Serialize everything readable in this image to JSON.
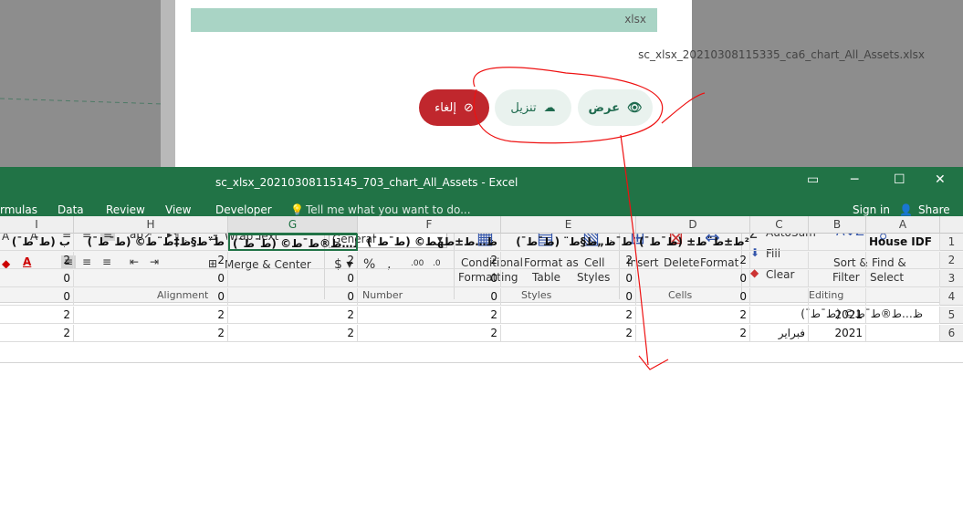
{
  "dialog": {
    "file_type": "xlsx",
    "file_name": "sc_xlsx_20210308115335_ca6_chart_All_Assets.xlsx",
    "view_label": "عرض",
    "download_label": "تنزيل",
    "cancel_label": "إلغاء"
  },
  "excel": {
    "window_title": "sc_xlsx_20210308115145_703_chart_All_Assets - Excel",
    "tabs": [
      "rmulas",
      "Data",
      "Review",
      "View",
      "Developer"
    ],
    "tell_me": "Tell me what you want to do...",
    "sign_in": "Sign in",
    "share": "Share",
    "ribbon": {
      "wrap_text": "Wrap Text",
      "merge_center": "Merge & Center",
      "number_format": "General",
      "conditional": "Conditional",
      "formatting": "Formatting",
      "format_as": "Format as",
      "table": "Table",
      "cell": "Cell",
      "styles": "Styles",
      "insert": "Insert",
      "delete": "Delete",
      "format": "Format",
      "autosum": "AutoSum",
      "fill": "Fill",
      "clear": "Clear",
      "sort": "Sort &",
      "filter": "Filter",
      "find": "Find &",
      "select": "Select",
      "group_alignment": "Alignment",
      "group_number": "Number",
      "group_styles": "Styles",
      "group_cells": "Cells",
      "group_editing": "Editing"
    },
    "formula_text": "ظ…ط®ط¯ط© (ط¯ط¯)",
    "columns": [
      "I",
      "H",
      "G",
      "F",
      "E",
      "D",
      "C",
      "B",
      "A"
    ],
    "header_row": [
      "ب (ط¯ط¯)",
      "ط¨ط§ظ‡ط¨ط© (ط¯ط¯)",
      "ظ…ط®ط¯ط© (ط¯ط¯)",
      "ظ…ط±طھط© (ط¯ط¯)",
      "ط¯ظ„ط§ط¨ (ط¯ط¯)",
      "ط²ط±ط¨ط± (ط¯ط¯)",
      "",
      "",
      "House IDF"
    ],
    "rows": [
      {
        "n": "2",
        "vals": [
          "2",
          "2",
          "2",
          "2",
          "2",
          "2",
          "",
          "",
          ""
        ]
      },
      {
        "n": "3",
        "vals": [
          "0",
          "0",
          "0",
          "0",
          "0",
          "0",
          "",
          "",
          ""
        ]
      },
      {
        "n": "4",
        "vals": [
          "0",
          "0",
          "0",
          "0",
          "0",
          "0",
          "",
          "",
          ""
        ]
      },
      {
        "n": "5",
        "vals": [
          "2",
          "2",
          "2",
          "2",
          "2",
          "2",
          "",
          "2021",
          ""
        ]
      },
      {
        "n": "6",
        "vals": [
          "2",
          "2",
          "2",
          "2",
          "2",
          "2",
          "فبراير",
          "2021",
          ""
        ]
      }
    ],
    "row1": "1"
  }
}
